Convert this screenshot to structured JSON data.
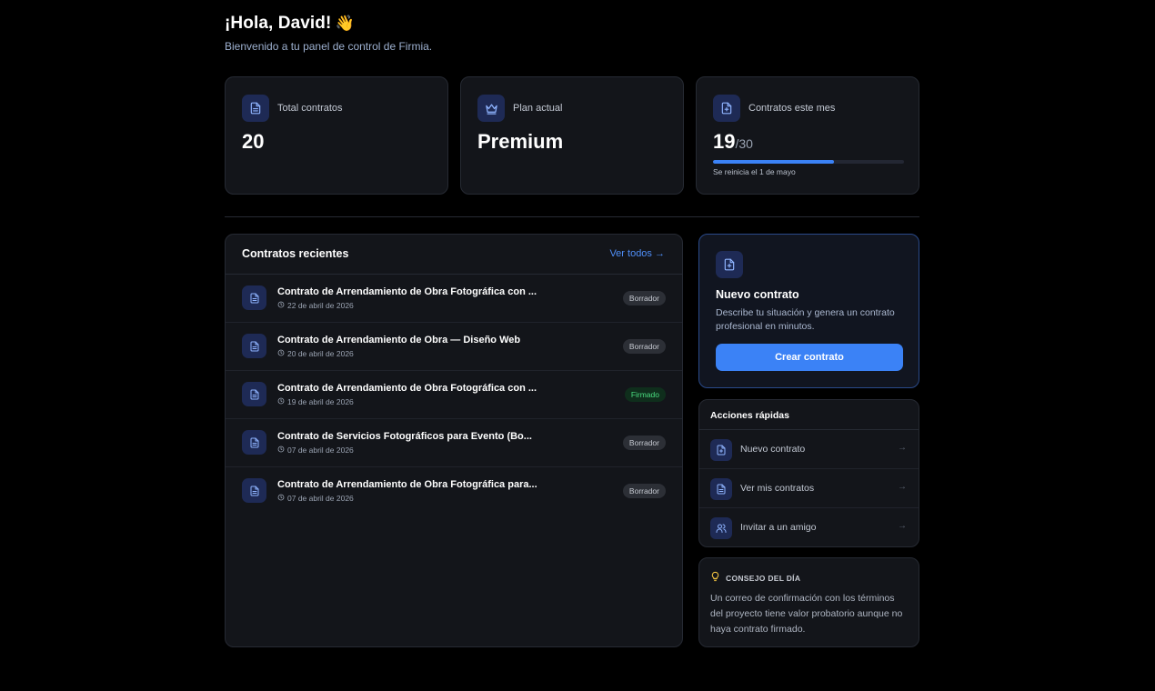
{
  "header": {
    "greeting": "¡Hola, David!",
    "wave": "👋",
    "subtitle": "Bienvenido a tu panel de control de Firmia."
  },
  "stats": {
    "total": {
      "label": "Total contratos",
      "value": "20",
      "icon": "document-icon"
    },
    "plan": {
      "label": "Plan actual",
      "value": "Premium",
      "icon": "crown-icon"
    },
    "month": {
      "label": "Contratos este mes",
      "value": "19",
      "denominator": "/30",
      "progress": 0.633,
      "reset": "Se reinicia el 1 de mayo",
      "icon": "document-plus-icon"
    }
  },
  "recent": {
    "title": "Contratos recientes",
    "see_all": "Ver todos →",
    "items": [
      {
        "title": "Contrato de Arrendamiento de Obra Fotográfica con ...",
        "date": "22 de abril de 2026",
        "status": "Borrador"
      },
      {
        "title": "Contrato de Arrendamiento de Obra — Diseño Web",
        "date": "20 de abril de 2026",
        "status": "Borrador"
      },
      {
        "title": "Contrato de Arrendamiento de Obra Fotográfica con ...",
        "date": "19 de abril de 2026",
        "status": "Firmado"
      },
      {
        "title": "Contrato de Servicios Fotográficos para Evento (Bo...",
        "date": "07 de abril de 2026",
        "status": "Borrador"
      },
      {
        "title": "Contrato de Arrendamiento de Obra Fotográfica para...",
        "date": "07 de abril de 2026",
        "status": "Borrador"
      }
    ]
  },
  "new_contract": {
    "title": "Nuevo contrato",
    "description": "Describe tu situación y genera un contrato profesional en minutos.",
    "button": "Crear contrato"
  },
  "quick_actions": {
    "title": "Acciones rápidas",
    "items": [
      {
        "label": "Nuevo contrato",
        "icon": "document-plus-icon",
        "arrow": "→"
      },
      {
        "label": "Ver mis contratos",
        "icon": "document-icon",
        "arrow": "→"
      },
      {
        "label": "Invitar a un amigo",
        "icon": "users-icon",
        "arrow": "→"
      }
    ]
  },
  "tip": {
    "title": "CONSEJO DEL DÍA",
    "body": "Un correo de confirmación con los términos del proyecto tiene valor probatorio aunque no haya contrato firmado."
  },
  "colors": {
    "background": "#000000",
    "card": "#13151a",
    "accent": "#3b82f6",
    "icon_bg": "#1e2a55",
    "signed": "#4ade80"
  }
}
